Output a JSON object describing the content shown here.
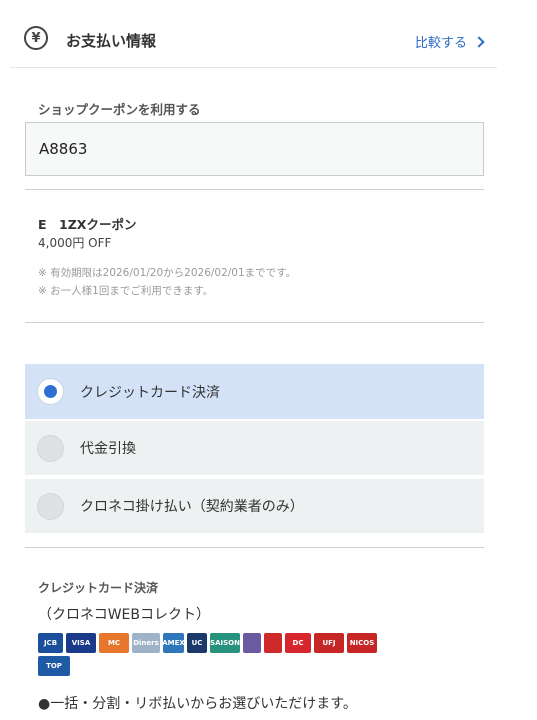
{
  "header": {
    "title": "お支払い情報",
    "compare_label": "比較する",
    "icon": "yen-icon",
    "icon_glyph": "¥"
  },
  "coupon": {
    "label": "ショップクーポンを利用する",
    "input_value": "A8863",
    "name": "E　1ZXクーポン",
    "amount": "4,000円 OFF",
    "notes": [
      "※ 有効期限は2026/01/20から2026/02/01までです。",
      "※ お一人様1回までご利用できます。"
    ]
  },
  "payment": {
    "options": [
      {
        "label": "クレジットカード決済",
        "selected": true
      },
      {
        "label": "代金引換",
        "selected": false
      },
      {
        "label": "クロネコ掛け払い（契約業者のみ）",
        "selected": false
      }
    ]
  },
  "credit": {
    "title": "クレジットカード決済",
    "subtitle": "（クロネコWEBコレクト）",
    "cards": [
      {
        "label": "JCB",
        "color": "#1a4f9c"
      },
      {
        "label": "VISA",
        "color": "#1a3a8a"
      },
      {
        "label": "MC",
        "color": "#e8772e"
      },
      {
        "label": "Diners",
        "color": "#9fb3c8"
      },
      {
        "label": "AMEX",
        "color": "#2e77bb"
      },
      {
        "label": "UC",
        "color": "#1b3a6b"
      },
      {
        "label": "SAISON",
        "color": "#27927d"
      },
      {
        "label": "",
        "color": "#6a5aa0"
      },
      {
        "label": "",
        "color": "#cf2a2a"
      },
      {
        "label": "DC",
        "color": "#d8262e"
      },
      {
        "label": "UFJ",
        "color": "#c62626"
      },
      {
        "label": "NICOS",
        "color": "#c62626"
      },
      {
        "label": "TOP",
        "color": "#1f5aa6"
      }
    ],
    "footnote": "●一括・分割・リボ払いからお選びいただけます。"
  }
}
